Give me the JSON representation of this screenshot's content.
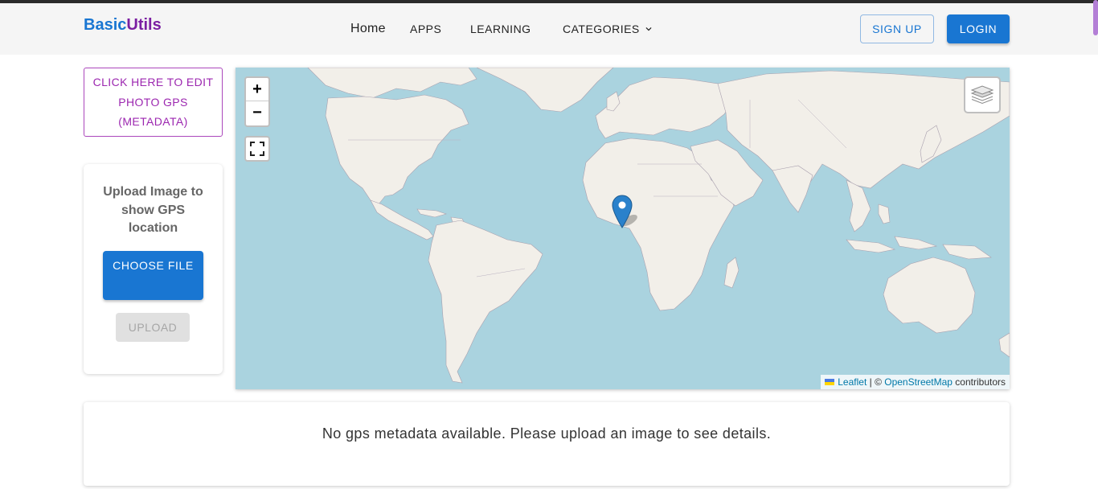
{
  "brand": {
    "part1": "Basic",
    "part2": "Utils",
    "color1": "#1976d2",
    "color2": "#7b1fa2"
  },
  "nav": {
    "home": "Home",
    "apps": "APPS",
    "learning": "LEARNING",
    "categories": "CATEGORIES",
    "categories_icon": "chevron-down-icon"
  },
  "auth": {
    "signup": "SIGN UP",
    "login": "LOGIN"
  },
  "sidebar": {
    "edit_link": "CLICK HERE TO EDIT PHOTO GPS (METADATA)",
    "upload_title": "Upload Image to show GPS location",
    "choose_file": "CHOOSE FILE",
    "upload": "UPLOAD"
  },
  "map": {
    "zoom_in": "+",
    "zoom_out": "−",
    "fullscreen_icon": "fullscreen-icon",
    "layers_icon": "layers-icon",
    "marker_icon": "map-pin-icon",
    "attribution": {
      "leaflet": "Leaflet",
      "separator": " | © ",
      "osm": "OpenStreetMap",
      "contributors": " contributors"
    },
    "water_color": "#aad3df",
    "land_color": "#f2efe9"
  },
  "result": {
    "message": "No gps metadata available. Please upload an image to see details."
  },
  "colors": {
    "primary": "#1976d2",
    "secondary": "#9c27b0"
  }
}
